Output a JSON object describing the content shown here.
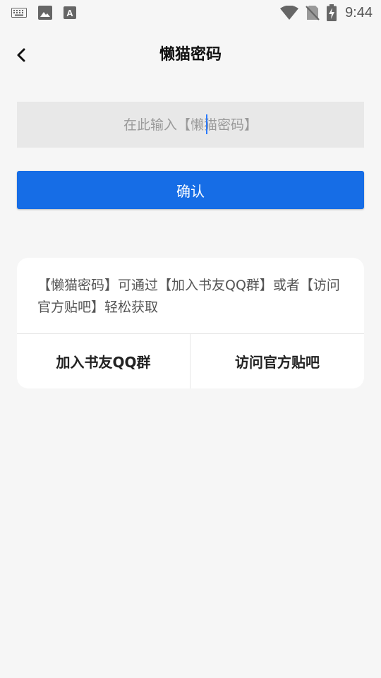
{
  "status_bar": {
    "time": "9:44",
    "icons": [
      "keyboard-icon",
      "image-icon",
      "font-icon",
      "wifi-icon",
      "no-sim-icon",
      "battery-charging-icon"
    ]
  },
  "header": {
    "back_icon": "chevron-left-icon",
    "title": "懒猫密码"
  },
  "password_input": {
    "placeholder": "在此输入【懒猫密码】",
    "value": ""
  },
  "confirm_button": {
    "label": "确认",
    "color": "#166de6"
  },
  "info_card": {
    "text": "【懒猫密码】可通过【加入书友QQ群】或者【访问官方贴吧】轻松获取",
    "actions": {
      "join_qq_group": "加入书友QQ群",
      "visit_tieba": "访问官方贴吧"
    }
  },
  "colors": {
    "background": "#f6f6f6",
    "accent": "#166de6",
    "input_bg": "#e8e8e8",
    "card_bg": "#ffffff"
  }
}
